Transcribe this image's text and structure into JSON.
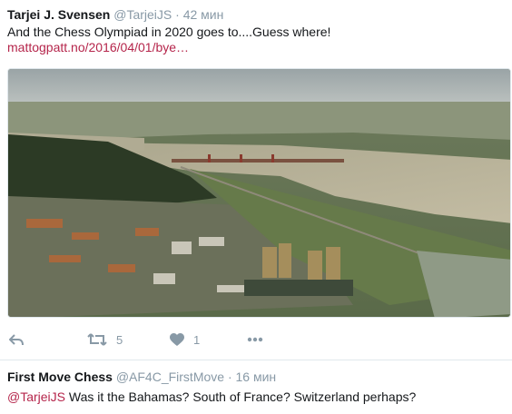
{
  "tweets": [
    {
      "name": "Tarjei J. Svensen",
      "handle": "@TarjeiJS",
      "time": "42 мин",
      "text": "And the Chess Olympiad in 2020 goes to....Guess where!",
      "link": "mattogpatt.no/2016/04/01/bye…",
      "media": "aerial photo of a riverside city with a bridge",
      "actions": {
        "retweets": "5",
        "likes": "1"
      }
    },
    {
      "name": "First Move Chess",
      "handle": "@AF4C_FirstMove",
      "time": "16 мин",
      "mention": "@TarjeiJS",
      "text": " Was it the Bahamas? South of France? Switzerland perhaps?"
    }
  ],
  "colors": {
    "link": "#b5254b",
    "muted": "#8899a6",
    "text": "#14171a",
    "border": "#e1e8ed"
  }
}
